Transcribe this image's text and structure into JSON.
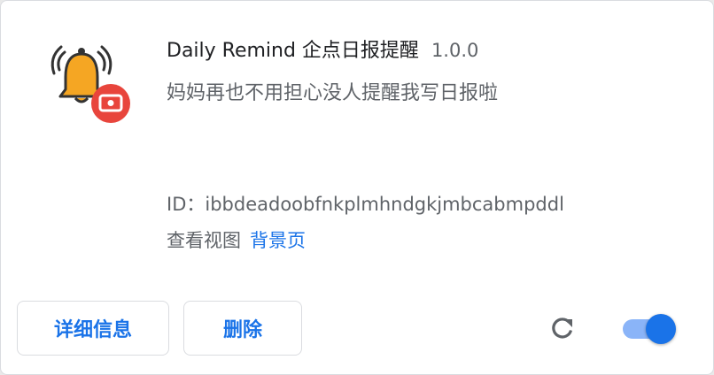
{
  "extension": {
    "name": "Daily Remind 企点日报提醒",
    "version": "1.0.0",
    "description": "妈妈再也不用担心没人提醒我写日报啦",
    "id_label": "ID：",
    "id_value": "ibbdeadoobfnkplmhndgkjmbcabmpddl",
    "views_label": "查看视图",
    "views_link": "背景页",
    "icon": "bell-notification-icon",
    "enabled": true
  },
  "buttons": {
    "details": "详细信息",
    "remove": "删除"
  },
  "icons": {
    "reload": "reload-icon"
  },
  "colors": {
    "accent": "#1a73e8",
    "toggle_track": "#8ab4f8",
    "bell": "#f5a623",
    "badge": "#e8453c"
  }
}
